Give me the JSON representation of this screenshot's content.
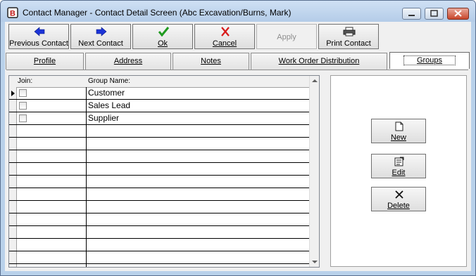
{
  "window": {
    "title": "Contact Manager - Contact Detail Screen (Abc Excavation/Burns, Mark)",
    "icon": "app-logo-icon"
  },
  "toolbar": {
    "previous_contact": "Previous Contact",
    "next_contact": "Next Contact",
    "ok": "Ok",
    "cancel": "Cancel",
    "apply": "Apply",
    "print_contact": "Print Contact"
  },
  "tabs": {
    "profile": "Profile",
    "address": "Address",
    "notes": "Notes",
    "work_order_distribution": "Work Order Distribution",
    "groups": "Groups",
    "active": "Groups"
  },
  "grid": {
    "col_join": "Join:",
    "col_group_name": "Group Name:",
    "rows": [
      {
        "join": false,
        "name": "Customer"
      },
      {
        "join": false,
        "name": "Sales Lead"
      },
      {
        "join": false,
        "name": "Supplier"
      },
      {
        "join": false,
        "name": ""
      },
      {
        "join": false,
        "name": ""
      },
      {
        "join": false,
        "name": ""
      },
      {
        "join": false,
        "name": ""
      },
      {
        "join": false,
        "name": ""
      },
      {
        "join": false,
        "name": ""
      },
      {
        "join": false,
        "name": ""
      },
      {
        "join": false,
        "name": ""
      },
      {
        "join": false,
        "name": ""
      },
      {
        "join": false,
        "name": ""
      },
      {
        "join": false,
        "name": ""
      },
      {
        "join": false,
        "name": ""
      }
    ]
  },
  "side_buttons": {
    "new": "New",
    "edit": "Edit",
    "delete": "Delete"
  },
  "colors": {
    "arrow_blue": "#1c34d8",
    "ok_green": "#1f9a1f",
    "cancel_red": "#d81a1a"
  }
}
